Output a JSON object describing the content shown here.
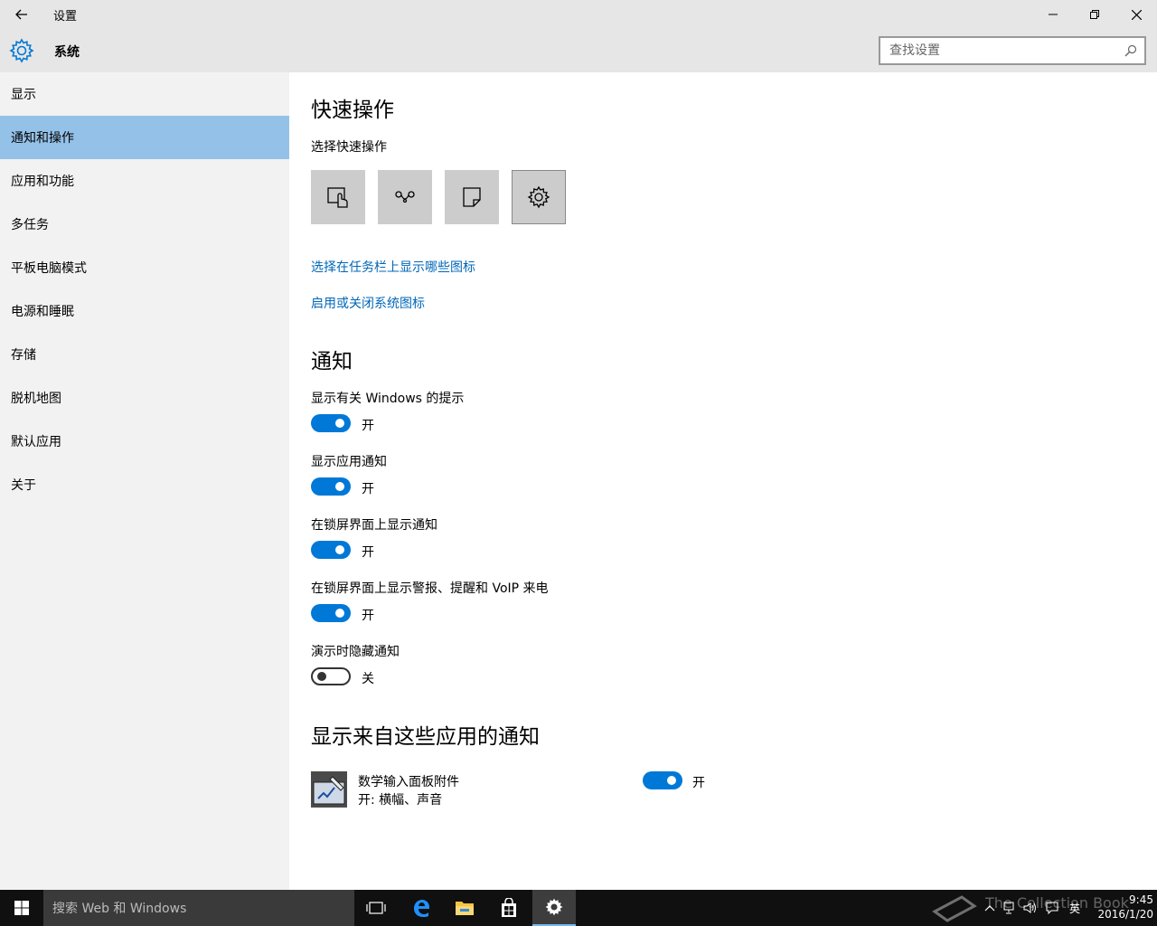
{
  "window": {
    "title": "设置",
    "controls": {
      "minimize": "minimize",
      "restore": "restore",
      "close": "close"
    }
  },
  "header": {
    "title": "系统",
    "search_placeholder": "查找设置"
  },
  "sidebar": {
    "items": [
      {
        "label": "显示",
        "selected": false
      },
      {
        "label": "通知和操作",
        "selected": true
      },
      {
        "label": "应用和功能",
        "selected": false
      },
      {
        "label": "多任务",
        "selected": false
      },
      {
        "label": "平板电脑模式",
        "selected": false
      },
      {
        "label": "电源和睡眠",
        "selected": false
      },
      {
        "label": "存储",
        "selected": false
      },
      {
        "label": "脱机地图",
        "selected": false
      },
      {
        "label": "默认应用",
        "selected": false
      },
      {
        "label": "关于",
        "selected": false
      }
    ]
  },
  "main": {
    "quick_actions": {
      "heading": "快速操作",
      "subheading": "选择快速操作",
      "tiles": [
        {
          "icon": "tablet-mode-icon"
        },
        {
          "icon": "connect-icon"
        },
        {
          "icon": "note-icon"
        },
        {
          "icon": "settings-gear-icon",
          "active": true
        }
      ],
      "link_taskbar_icons": "选择在任务栏上显示哪些图标",
      "link_system_icons": "启用或关闭系统图标"
    },
    "notifications": {
      "heading": "通知",
      "settings": [
        {
          "label": "显示有关 Windows 的提示",
          "state": "开",
          "on": true
        },
        {
          "label": "显示应用通知",
          "state": "开",
          "on": true
        },
        {
          "label": "在锁屏界面上显示通知",
          "state": "开",
          "on": true
        },
        {
          "label": "在锁屏界面上显示警报、提醒和 VoIP 来电",
          "state": "开",
          "on": true
        },
        {
          "label": "演示时隐藏通知",
          "state": "关",
          "on": false
        }
      ]
    },
    "apps": {
      "heading": "显示来自这些应用的通知",
      "items": [
        {
          "name": "数学输入面板附件",
          "subtitle": "开: 横幅、声音",
          "state": "开",
          "on": true
        }
      ]
    }
  },
  "taskbar": {
    "search_placeholder": "搜索 Web 和 Windows",
    "ime": "英",
    "time": "9:45",
    "date": "2016/1/20",
    "watermark": "The Collection Book"
  },
  "colors": {
    "accent": "#0078d7",
    "selected_nav": "#94c1e8",
    "link": "#0067b8",
    "chrome": "#e6e6e6",
    "sidebar": "#f2f2f2",
    "taskbar": "#101010"
  }
}
